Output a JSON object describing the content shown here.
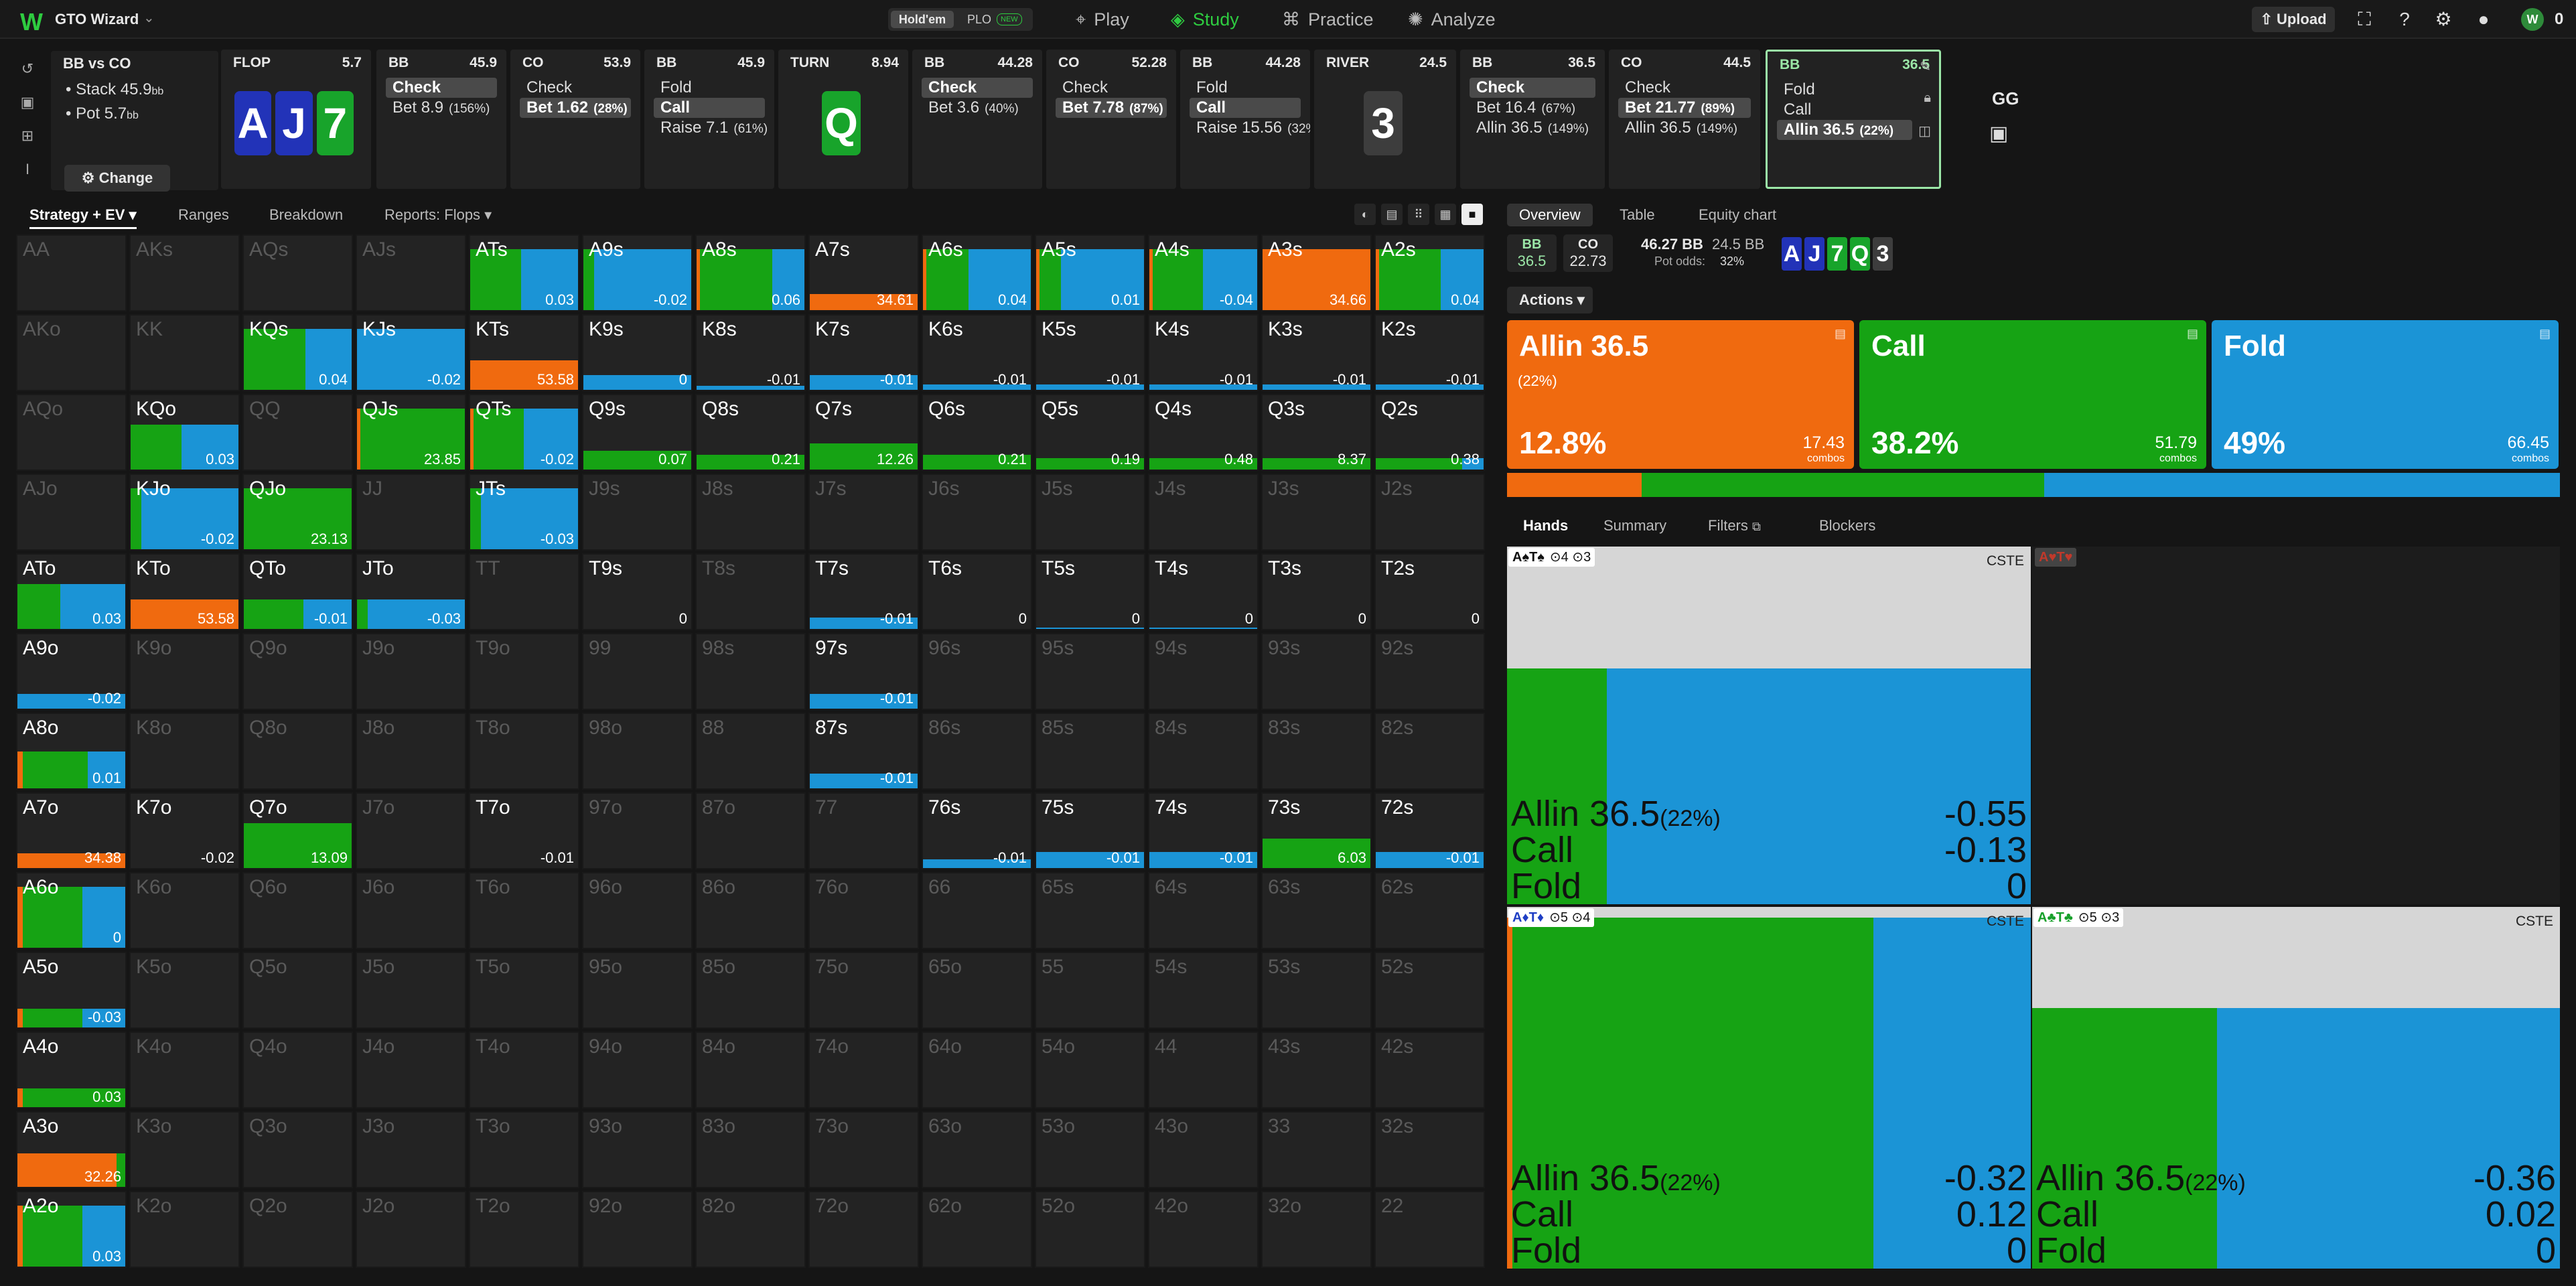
{
  "app": {
    "brand": "GTO Wizard",
    "mode_active": "Hold'em",
    "mode_other": "PLO",
    "mode_badge": "NEW",
    "upload": "Upload",
    "coins": "0",
    "avatar_label": "W"
  },
  "nav": [
    {
      "label": "Play",
      "icon": "play-icon"
    },
    {
      "label": "Study",
      "icon": "study-icon",
      "active": true
    },
    {
      "label": "Practice",
      "icon": "practice-icon"
    },
    {
      "label": "Analyze",
      "icon": "analyze-icon"
    }
  ],
  "spot": {
    "matchup": "BB vs CO",
    "stack_label": "Stack",
    "stack_value": "45.9",
    "pot_label": "Pot",
    "pot_value": "5.7",
    "unit": "bb",
    "change": "Change"
  },
  "nodes": [
    {
      "kind": "street",
      "street": "FLOP",
      "pot": "5.7",
      "cards": [
        {
          "r": "A",
          "s": "d"
        },
        {
          "r": "J",
          "s": "d"
        },
        {
          "r": "7",
          "s": "c"
        }
      ]
    },
    {
      "kind": "action",
      "player": "BB",
      "stack": "45.9",
      "actions": [
        {
          "label": "Check",
          "pct": "",
          "hl": true
        },
        {
          "label": "Bet 8.9",
          "pct": "(156%)"
        }
      ]
    },
    {
      "kind": "action",
      "player": "CO",
      "stack": "53.9",
      "actions": [
        {
          "label": "Check",
          "pct": ""
        },
        {
          "label": "Bet 1.62",
          "pct": "(28%)",
          "hl": true
        }
      ]
    },
    {
      "kind": "action",
      "player": "BB",
      "stack": "45.9",
      "actions": [
        {
          "label": "Fold",
          "pct": ""
        },
        {
          "label": "Call",
          "pct": "",
          "hl": true
        },
        {
          "label": "Raise 7.1",
          "pct": "(61%)"
        }
      ]
    },
    {
      "kind": "street",
      "street": "TURN",
      "pot": "8.94",
      "cards": [
        {
          "r": "Q",
          "s": "s"
        }
      ]
    },
    {
      "kind": "action",
      "player": "BB",
      "stack": "44.28",
      "actions": [
        {
          "label": "Check",
          "pct": "",
          "hl": true
        },
        {
          "label": "Bet 3.6",
          "pct": "(40%)"
        }
      ]
    },
    {
      "kind": "action",
      "player": "CO",
      "stack": "52.28",
      "actions": [
        {
          "label": "Check",
          "pct": ""
        },
        {
          "label": "Bet 7.78",
          "pct": "(87%)",
          "hl": true
        }
      ]
    },
    {
      "kind": "action",
      "player": "BB",
      "stack": "44.28",
      "actions": [
        {
          "label": "Fold",
          "pct": ""
        },
        {
          "label": "Call",
          "pct": "",
          "hl": true
        },
        {
          "label": "Raise 15.56",
          "pct": "(32%)"
        }
      ]
    },
    {
      "kind": "street",
      "street": "RIVER",
      "pot": "24.5",
      "cards": [
        {
          "r": "3",
          "s": "x"
        }
      ]
    },
    {
      "kind": "action",
      "player": "BB",
      "stack": "36.5",
      "actions": [
        {
          "label": "Check",
          "pct": "",
          "hl": true
        },
        {
          "label": "Bet 16.4",
          "pct": "(67%)"
        },
        {
          "label": "Allin 36.5",
          "pct": "(149%)"
        }
      ]
    },
    {
      "kind": "action",
      "player": "CO",
      "stack": "44.5",
      "actions": [
        {
          "label": "Check",
          "pct": ""
        },
        {
          "label": "Bet 21.77",
          "pct": "(89%)",
          "hl": true
        },
        {
          "label": "Allin 36.5",
          "pct": "(149%)"
        }
      ]
    },
    {
      "kind": "action",
      "player": "BB",
      "stack": "36.5",
      "selected": true,
      "actions": [
        {
          "label": "Fold",
          "pct": ""
        },
        {
          "label": "Call",
          "pct": ""
        },
        {
          "label": "Allin 36.5",
          "pct": "(22%)",
          "hl": true
        }
      ]
    }
  ],
  "gg": {
    "label": "GG"
  },
  "left_tabs": [
    {
      "label": "Strategy + EV",
      "active": true
    },
    {
      "label": "Ranges"
    },
    {
      "label": "Breakdown"
    },
    {
      "label": "Reports: Flops"
    }
  ],
  "ranks": [
    "A",
    "K",
    "Q",
    "J",
    "T",
    "9",
    "8",
    "7",
    "6",
    "5",
    "4",
    "3",
    "2"
  ],
  "colors": {
    "allin": "#f06a0f",
    "call": "#16a314",
    "fold": "#1b94d6",
    "bg": "#151515"
  },
  "cells": {
    "ATs": {
      "a": 0,
      "c": 47,
      "f": 53,
      "h": 0.82,
      "ev": "0.03"
    },
    "A9s": {
      "a": 0,
      "c": 10,
      "f": 90,
      "h": 0.82,
      "ev": "-0.02"
    },
    "A8s": {
      "a": 3,
      "c": 67,
      "f": 30,
      "h": 0.82,
      "ev": "0.06"
    },
    "A7s": {
      "a": 100,
      "c": 0,
      "f": 0,
      "h": 0.22,
      "ev": "34.61"
    },
    "A6s": {
      "a": 3,
      "c": 39,
      "f": 58,
      "h": 0.82,
      "ev": "0.04"
    },
    "A5s": {
      "a": 3,
      "c": 20,
      "f": 77,
      "h": 0.82,
      "ev": "0.01"
    },
    "A4s": {
      "a": 3,
      "c": 47,
      "f": 50,
      "h": 0.82,
      "ev": "-0.04"
    },
    "A3s": {
      "a": 100,
      "c": 0,
      "f": 0,
      "h": 0.82,
      "ev": "34.66"
    },
    "A2s": {
      "a": 3,
      "c": 57,
      "f": 40,
      "h": 0.82,
      "ev": "0.04"
    },
    "KQs": {
      "a": 0,
      "c": 57,
      "f": 43,
      "h": 0.82,
      "ev": "0.04"
    },
    "KJs": {
      "a": 0,
      "c": 0,
      "f": 100,
      "h": 0.82,
      "ev": "-0.02"
    },
    "KTs": {
      "a": 100,
      "c": 0,
      "f": 0,
      "h": 0.4,
      "ev": "53.58"
    },
    "K9s": {
      "a": 0,
      "c": 0,
      "f": 100,
      "h": 0.2,
      "ev": "0"
    },
    "K8s": {
      "a": 0,
      "c": 0,
      "f": 100,
      "h": 0.05,
      "ev": "-0.01"
    },
    "K7s": {
      "a": 0,
      "c": 0,
      "f": 100,
      "h": 0.2,
      "ev": "-0.01"
    },
    "K6s": {
      "a": 0,
      "c": 0,
      "f": 100,
      "h": 0.07,
      "ev": "-0.01"
    },
    "K5s": {
      "a": 0,
      "c": 0,
      "f": 100,
      "h": 0.07,
      "ev": "-0.01"
    },
    "K4s": {
      "a": 0,
      "c": 0,
      "f": 100,
      "h": 0.07,
      "ev": "-0.01"
    },
    "K3s": {
      "a": 0,
      "c": 0,
      "f": 100,
      "h": 0.07,
      "ev": "-0.01"
    },
    "K2s": {
      "a": 0,
      "c": 0,
      "f": 100,
      "h": 0.07,
      "ev": "-0.01"
    },
    "KQo": {
      "a": 0,
      "c": 47,
      "f": 53,
      "h": 0.6,
      "ev": "0.03"
    },
    "QJs": {
      "a": 3,
      "c": 97,
      "f": 0,
      "h": 0.82,
      "ev": "23.85"
    },
    "QTs": {
      "a": 3,
      "c": 47,
      "f": 50,
      "h": 0.82,
      "ev": "-0.02"
    },
    "Q9s": {
      "a": 0,
      "c": 100,
      "f": 0,
      "h": 0.25,
      "ev": "0.07"
    },
    "Q8s": {
      "a": 0,
      "c": 100,
      "f": 0,
      "h": 0.2,
      "ev": "0.21"
    },
    "Q7s": {
      "a": 0,
      "c": 100,
      "f": 0,
      "h": 0.35,
      "ev": "12.26"
    },
    "Q6s": {
      "a": 0,
      "c": 100,
      "f": 0,
      "h": 0.2,
      "ev": "0.21"
    },
    "Q5s": {
      "a": 0,
      "c": 100,
      "f": 0,
      "h": 0.15,
      "ev": "0.19"
    },
    "Q4s": {
      "a": 0,
      "c": 100,
      "f": 0,
      "h": 0.15,
      "ev": "0.48"
    },
    "Q3s": {
      "a": 0,
      "c": 100,
      "f": 0,
      "h": 0.15,
      "ev": "8.37"
    },
    "Q2s": {
      "a": 0,
      "c": 80,
      "f": 20,
      "h": 0.15,
      "ev": "0.38"
    },
    "KJo": {
      "a": 0,
      "c": 10,
      "f": 90,
      "h": 0.82,
      "ev": "-0.02"
    },
    "QJo": {
      "a": 0,
      "c": 100,
      "f": 0,
      "h": 0.82,
      "ev": "23.13"
    },
    "JTs": {
      "a": 0,
      "c": 10,
      "f": 90,
      "h": 0.82,
      "ev": "-0.03"
    },
    "ATo": {
      "a": 0,
      "c": 40,
      "f": 60,
      "h": 0.6,
      "ev": "0.03"
    },
    "KTo": {
      "a": 100,
      "c": 0,
      "f": 0,
      "h": 0.4,
      "ev": "53.58"
    },
    "QTo": {
      "a": 0,
      "c": 55,
      "f": 45,
      "h": 0.4,
      "ev": "-0.01"
    },
    "JTo": {
      "a": 0,
      "c": 10,
      "f": 90,
      "h": 0.4,
      "ev": "-0.03"
    },
    "T9s": {
      "a": 0,
      "c": 0,
      "f": 0,
      "h": 0,
      "ev": "0"
    },
    "T7s": {
      "a": 0,
      "c": 0,
      "f": 100,
      "h": 0.15,
      "ev": "-0.01"
    },
    "T6s": {
      "a": 0,
      "c": 0,
      "f": 0,
      "h": 0,
      "ev": "0"
    },
    "T5s": {
      "a": 0,
      "c": 0,
      "f": 100,
      "h": 0.02,
      "ev": "0"
    },
    "T4s": {
      "a": 0,
      "c": 0,
      "f": 100,
      "h": 0.02,
      "ev": "0"
    },
    "T3s": {
      "a": 0,
      "c": 0,
      "f": 0,
      "h": 0,
      "ev": "0"
    },
    "T2s": {
      "a": 0,
      "c": 0,
      "f": 0,
      "h": 0,
      "ev": "0"
    },
    "A9o": {
      "a": 0,
      "c": 0,
      "f": 100,
      "h": 0.2,
      "ev": "-0.02"
    },
    "97s": {
      "a": 0,
      "c": 0,
      "f": 100,
      "h": 0.2,
      "ev": "-0.01"
    },
    "A8o": {
      "a": 5,
      "c": 60,
      "f": 35,
      "h": 0.5,
      "ev": "0.01"
    },
    "87s": {
      "a": 0,
      "c": 0,
      "f": 100,
      "h": 0.2,
      "ev": "-0.01"
    },
    "A7o": {
      "a": 100,
      "c": 0,
      "f": 0,
      "h": 0.2,
      "ev": "34.38"
    },
    "K7o": {
      "a": 0,
      "c": 0,
      "f": 0,
      "h": 0,
      "ev": "-0.02"
    },
    "Q7o": {
      "a": 0,
      "c": 100,
      "f": 0,
      "h": 0.6,
      "ev": "13.09"
    },
    "T7o": {
      "a": 0,
      "c": 0,
      "f": 0,
      "h": 0,
      "ev": "-0.01"
    },
    "76s": {
      "a": 0,
      "c": 0,
      "f": 100,
      "h": 0.12,
      "ev": "-0.01"
    },
    "75s": {
      "a": 0,
      "c": 0,
      "f": 100,
      "h": 0.22,
      "ev": "-0.01"
    },
    "74s": {
      "a": 0,
      "c": 0,
      "f": 100,
      "h": 0.22,
      "ev": "-0.01"
    },
    "73s": {
      "a": 0,
      "c": 100,
      "f": 0,
      "h": 0.4,
      "ev": "6.03"
    },
    "72s": {
      "a": 0,
      "c": 0,
      "f": 100,
      "h": 0.22,
      "ev": "-0.01"
    },
    "A6o": {
      "a": 5,
      "c": 55,
      "f": 40,
      "h": 0.82,
      "ev": "0"
    },
    "A5o": {
      "a": 5,
      "c": 55,
      "f": 40,
      "h": 0.25,
      "ev": "-0.03"
    },
    "A4o": {
      "a": 5,
      "c": 95,
      "f": 0,
      "h": 0.25,
      "ev": "0.03"
    },
    "A3o": {
      "a": 92,
      "c": 8,
      "f": 0,
      "h": 0.45,
      "ev": "32.26"
    },
    "A2o": {
      "a": 5,
      "c": 55,
      "f": 40,
      "h": 0.82,
      "ev": "0.03"
    }
  },
  "right_tabs": [
    {
      "label": "Overview",
      "active": true
    },
    {
      "label": "Table"
    },
    {
      "label": "Equity chart"
    }
  ],
  "players": [
    {
      "pos": "BB",
      "stack": "36.5"
    },
    {
      "pos": "CO",
      "stack": "22.73"
    }
  ],
  "pot_info": {
    "pot": "46.27 BB",
    "stack": "24.5 BB",
    "odds_label": "Pot odds:",
    "odds": "32%"
  },
  "board": [
    {
      "r": "A",
      "s": "d"
    },
    {
      "r": "J",
      "s": "d"
    },
    {
      "r": "7",
      "s": "c"
    },
    {
      "r": "Q",
      "s": "s"
    },
    {
      "r": "3",
      "s": "x"
    }
  ],
  "actions_dd": "Actions",
  "actions": [
    {
      "name": "Allin 36.5",
      "pct_bet": "(22%)",
      "freq": "12.8%",
      "combos": "17.43",
      "combos_label": "combos",
      "color": "allin",
      "share": 12.8
    },
    {
      "name": "Call",
      "pct_bet": "",
      "freq": "38.2%",
      "combos": "51.79",
      "combos_label": "combos",
      "color": "call",
      "share": 38.2
    },
    {
      "name": "Fold",
      "pct_bet": "",
      "freq": "49%",
      "combos": "66.45",
      "combos_label": "combos",
      "color": "fold",
      "share": 49
    }
  ],
  "hands_tabs": [
    {
      "label": "Hands",
      "active": true
    },
    {
      "label": "Summary"
    },
    {
      "label": "Filters"
    },
    {
      "label": "Blockers"
    }
  ],
  "hand_cards": [
    {
      "hand": "A♠T♠",
      "extra": "⊙4 ⊙3",
      "tag": "CSTE",
      "bars": {
        "a": 0,
        "c": 19,
        "f": 81
      },
      "fill": 0.66,
      "rows": [
        {
          "name": "Allin 36.5",
          "pct": "(22%)",
          "ev": "-0.55"
        },
        {
          "name": "Call",
          "pct": "",
          "ev": "-0.13"
        },
        {
          "name": "Fold",
          "pct": "",
          "ev": "0"
        }
      ]
    },
    {
      "hand": "A♦T♦",
      "extra": "⊙5 ⊙4",
      "tag": "CSTE",
      "bars": {
        "a": 1,
        "c": 69,
        "f": 30
      },
      "fill": 0.97,
      "rows": [
        {
          "name": "Allin 36.5",
          "pct": "(22%)",
          "ev": "-0.32"
        },
        {
          "name": "Call",
          "pct": "",
          "ev": "0.12"
        },
        {
          "name": "Fold",
          "pct": "",
          "ev": "0"
        }
      ]
    },
    {
      "hand": "A♣T♣",
      "extra": "⊙5 ⊙3",
      "tag": "CSTE",
      "bars": {
        "a": 0,
        "c": 35,
        "f": 65
      },
      "fill": 0.72,
      "rows": [
        {
          "name": "Allin 36.5",
          "pct": "(22%)",
          "ev": "-0.36"
        },
        {
          "name": "Call",
          "pct": "",
          "ev": "0.02"
        },
        {
          "name": "Fold",
          "pct": "",
          "ev": "0"
        }
      ]
    }
  ],
  "blank_hand": "A♥T♥"
}
